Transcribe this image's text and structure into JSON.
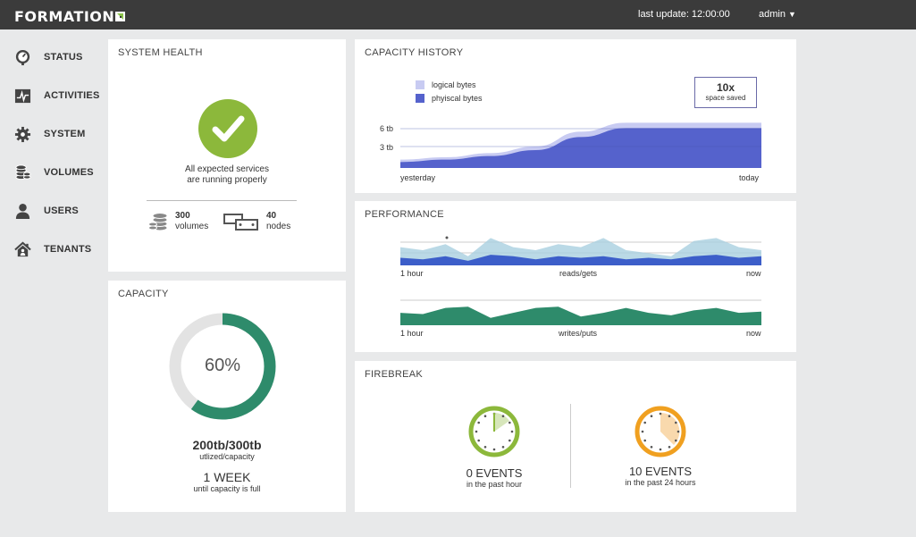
{
  "header": {
    "brand": "FORMATION",
    "last_update": "last update: 12:00:00",
    "user": "admin",
    "colors": {
      "bar": "#3b3b3b",
      "brand_accent": "#8bc34a"
    }
  },
  "sidebar": {
    "items": [
      {
        "label": "STATUS",
        "icon": "gauge-icon"
      },
      {
        "label": "ACTIVITIES",
        "icon": "activity-icon"
      },
      {
        "label": "SYSTEM",
        "icon": "gear-icon"
      },
      {
        "label": "VOLUMES",
        "icon": "database-icon"
      },
      {
        "label": "USERS",
        "icon": "user-icon"
      },
      {
        "label": "TENANTS",
        "icon": "house-icon"
      }
    ]
  },
  "system_health": {
    "title": "SYSTEM HEALTH",
    "status_line1": "All expected services",
    "status_line2": "are running properly",
    "status_color": "#8cb83b",
    "volumes_count": "300",
    "volumes_label": "volumes",
    "nodes_count": "40",
    "nodes_label": "nodes"
  },
  "capacity": {
    "title": "CAPACITY",
    "percent_label": "60%",
    "used_fraction": 0.6,
    "ring_color": "#2e8b6b",
    "track_color": "#e3e3e3",
    "usage": "200tb/300tb",
    "usage_caption": "utlized/capacity",
    "eta": "1 WEEK",
    "eta_caption": "until capacity is full"
  },
  "capacity_history": {
    "title": "CAPACITY HISTORY",
    "legend": [
      {
        "label": "logical bytes",
        "color": "#c8cbf2"
      },
      {
        "label": "phyiscal bytes",
        "color": "#5562cc"
      }
    ],
    "savings_value": "10x",
    "savings_caption": "space saved",
    "y_ticks": [
      "6 tb",
      "3 tb"
    ],
    "x_start": "yesterday",
    "x_end": "today"
  },
  "performance": {
    "title": "PERFORMANCE",
    "reads": {
      "x_start": "1 hour",
      "label": "reads/gets",
      "x_end": "now"
    },
    "writes": {
      "x_start": "1 hour",
      "label": "writes/puts",
      "x_end": "now"
    },
    "colors": {
      "reads_light": "#a9cfe0",
      "reads_dark": "#3c5ec9",
      "writes": "#2e8b6b"
    }
  },
  "firebreak": {
    "title": "FIREBREAK",
    "hour": {
      "value": "0 EVENTS",
      "caption": "in the past hour",
      "color": "#8cb83b"
    },
    "day": {
      "value": "10 EVENTS",
      "caption": "in the past 24 hours",
      "color": "#f0a020"
    }
  },
  "chart_data": [
    {
      "type": "area",
      "title": "CAPACITY HISTORY",
      "x": [
        "yesterday",
        "today"
      ],
      "y_ticks": [
        "3 tb",
        "6 tb"
      ],
      "series": [
        {
          "name": "logical bytes",
          "values": [
            0.8,
            1.2,
            1.9,
            3.0,
            5.5,
            7.0,
            7.0,
            7.0,
            7.0
          ]
        },
        {
          "name": "phyiscal bytes",
          "values": [
            0.4,
            0.8,
            1.4,
            2.4,
            4.6,
            6.1,
            6.1,
            6.1,
            6.1
          ]
        }
      ]
    },
    {
      "type": "area",
      "title": "reads/gets",
      "x": [
        "1 hour",
        "now"
      ],
      "series": [
        {
          "values": [
            0.6,
            0.5,
            0.7,
            0.3,
            0.9,
            0.6,
            0.5,
            0.7,
            0.6,
            0.9,
            0.5,
            0.4,
            0.3,
            0.8,
            0.9,
            0.6,
            0.5
          ]
        },
        {
          "values": [
            0.25,
            0.2,
            0.3,
            0.15,
            0.35,
            0.3,
            0.2,
            0.3,
            0.25,
            0.3,
            0.2,
            0.25,
            0.2,
            0.3,
            0.35,
            0.25,
            0.3
          ]
        }
      ]
    },
    {
      "type": "area",
      "title": "writes/puts",
      "x": [
        "1 hour",
        "now"
      ],
      "series": [
        {
          "values": [
            0.5,
            0.45,
            0.7,
            0.75,
            0.3,
            0.5,
            0.7,
            0.75,
            0.35,
            0.5,
            0.7,
            0.5,
            0.4,
            0.6,
            0.7,
            0.5,
            0.55
          ]
        }
      ]
    }
  ]
}
